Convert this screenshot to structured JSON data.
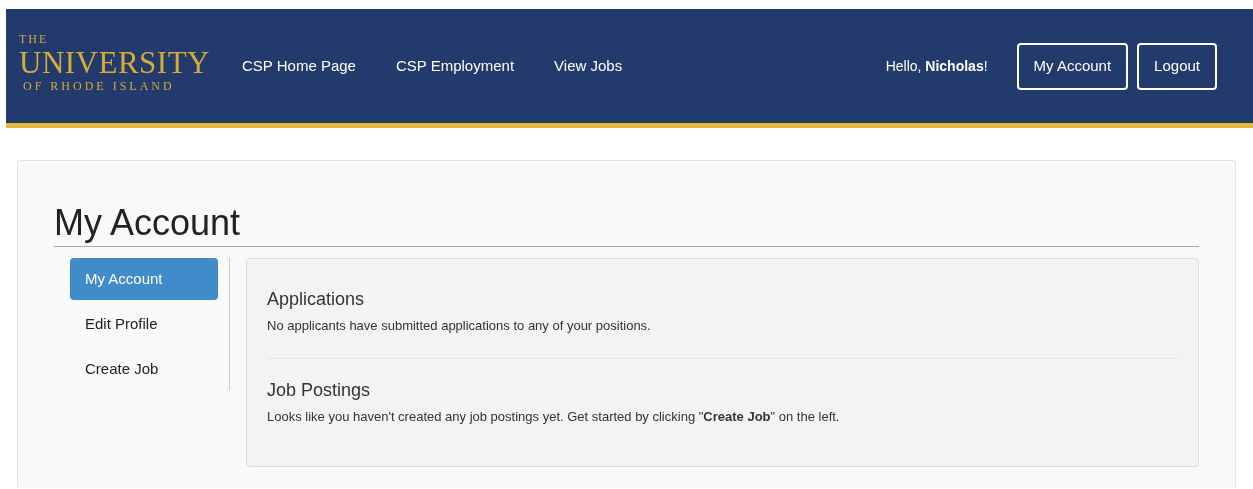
{
  "logo": {
    "line_1": "THE",
    "line_2": "UNIVERSITY",
    "line_3": "OF RHODE ISLAND"
  },
  "nav": [
    {
      "label": "CSP Home Page"
    },
    {
      "label": "CSP Employment"
    },
    {
      "label": "View Jobs"
    }
  ],
  "greeting": "Hello, **Nicholas**!",
  "header_buttons": [
    "My Account",
    "Logout"
  ],
  "page_title": "My Account",
  "sidebar": [
    {
      "label": "My Account",
      "selected": true
    },
    {
      "label": "Edit Profile",
      "selected": false
    },
    {
      "label": "Create Job",
      "selected": false
    }
  ],
  "sections": [
    {
      "title": "Applications",
      "text": "No applicants have submitted applications to any of your positions."
    },
    {
      "title": "Job Postings",
      "text": "Looks like you haven't created any job postings yet. Get started by clicking \"**Create Job**\" on the left."
    }
  ]
}
